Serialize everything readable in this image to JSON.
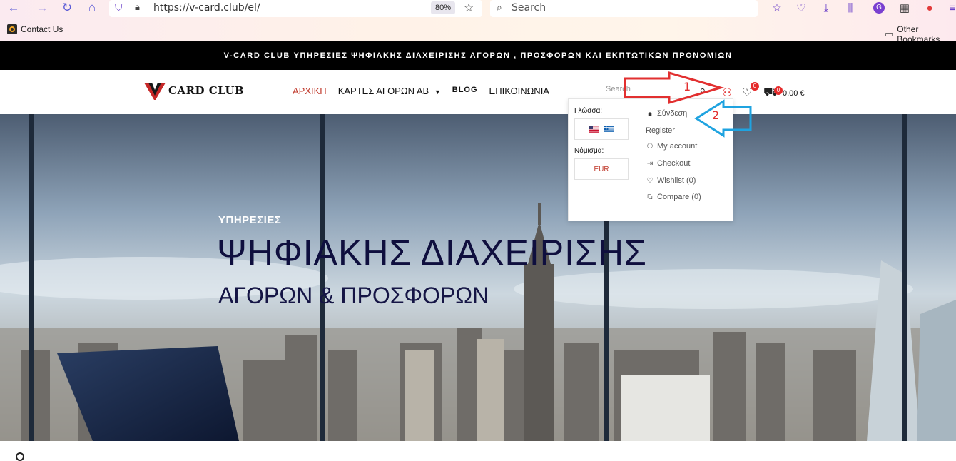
{
  "browser": {
    "url": "https://v-card.club/el/",
    "zoom": "80%",
    "search_placeholder": "Search",
    "bookmark_contact": "Contact Us",
    "bookmark_other": "Other Bookmarks",
    "profile_letter": "G"
  },
  "promo_bar": {
    "text": "V-CARD CLUB ΥΠΗΡΕΣΙΕΣ ΨΗΦΙΑΚΗΣ ΔΙΑΧΕΙΡΙΣΗΣ ΑΓΟΡΩΝ , ΠΡΟΣΦΟΡΩΝ ΚΑΙ ΕΚΠΤΩΤΙΚΩΝ ΠΡΟΝΟΜΙΩΝ"
  },
  "header": {
    "logo_text": "CARD CLUB",
    "menu": [
      "ΑΡΧΙΚΗ",
      "ΚΑΡΤΕΣ ΑΓΟΡΩΝ ΑΒ",
      "BLOG",
      "ΕΠΙΚΟΙΝΩΝΙΑ"
    ],
    "search_placeholder": "Search",
    "wishlist_count": "0",
    "cart_count": "0",
    "cart_total": "0,00 €"
  },
  "dropdown": {
    "language_label": "Γλώσσα:",
    "currency_label": "Νόμισμα:",
    "currency_value": "EUR",
    "login": "Σύνδεση",
    "register": "Register",
    "my_account": "My account",
    "checkout": "Checkout",
    "wishlist": "Wishlist (0)",
    "compare": "Compare (0)"
  },
  "hero": {
    "small": "ΥΠΗΡΕΣΙΕΣ",
    "title": "ΨΗΦΙΑΚΗΣ ΔΙΑΧΕΙΡΙΣΗΣ",
    "subtitle": "ΑΓΟΡΩΝ & ΠΡΟΣΦΟΡΩΝ"
  },
  "annotations": {
    "step1": "1",
    "step2": "2"
  },
  "colors": {
    "accent_red": "#c0392b",
    "annotation_red": "#e23030",
    "annotation_blue": "#1fa3e0"
  }
}
